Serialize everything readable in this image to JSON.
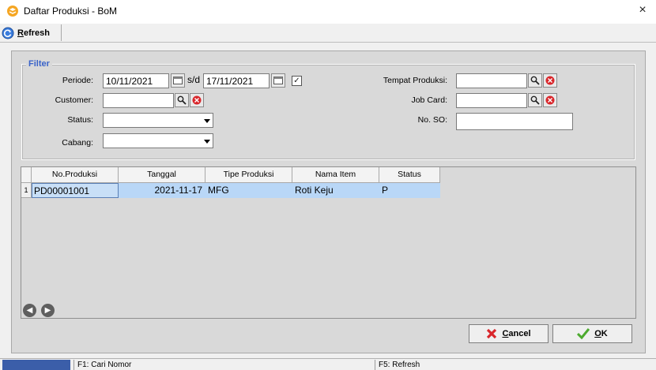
{
  "window": {
    "title": "Daftar Produksi - BoM",
    "close": "×"
  },
  "toolbar": {
    "refresh_label": "Refresh"
  },
  "filter": {
    "legend": "Filter",
    "periode_label": "Periode:",
    "periode_from": "10/11/2021",
    "periode_sep": "s/d",
    "periode_to": "17/11/2021",
    "periode_checked": true,
    "customer_label": "Customer:",
    "customer_value": "",
    "status_label": "Status:",
    "status_value": "",
    "cabang_label": "Cabang:",
    "cabang_value": "",
    "tempat_label": "Tempat Produksi:",
    "tempat_value": "",
    "jobcard_label": "Job Card:",
    "jobcard_value": "",
    "noso_label": "No. SO:",
    "noso_value": ""
  },
  "grid": {
    "columns": [
      "No.Produksi",
      "Tanggal",
      "Tipe Produksi",
      "Nama Item",
      "Status"
    ],
    "rows": [
      {
        "index": "1",
        "no_produksi": "PD00001001",
        "tanggal": "2021-11-17",
        "tipe": "MFG",
        "nama_item": "Roti Keju",
        "status": "P"
      }
    ]
  },
  "buttons": {
    "cancel": "Cancel",
    "ok": "OK"
  },
  "statusbar": {
    "hint1": "F1: Cari Nomor",
    "hint2": "F5: Refresh"
  },
  "colors": {
    "accent": "#3a63c9",
    "selected_row": "#b9d7f7",
    "status_blue": "#3b5ea9",
    "cancel_red": "#d9262b",
    "ok_green": "#4caa2e"
  }
}
